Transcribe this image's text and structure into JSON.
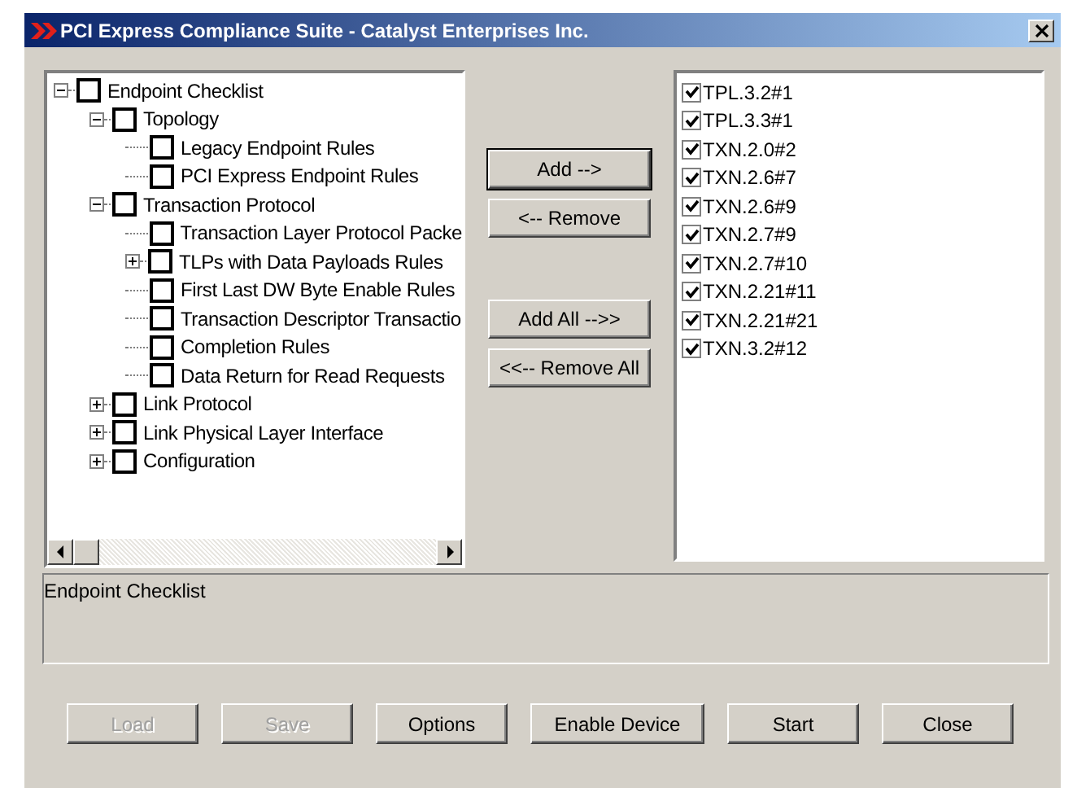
{
  "window": {
    "title": "PCI Express Compliance Suite - Catalyst Enterprises Inc."
  },
  "tree": [
    {
      "label": "Endpoint Checklist",
      "checked": false,
      "expanded": true,
      "children": [
        {
          "label": "Topology",
          "checked": false,
          "expanded": true,
          "children": [
            {
              "label": "Legacy Endpoint Rules",
              "checked": false
            },
            {
              "label": "PCI Express Endpoint Rules",
              "checked": false
            }
          ]
        },
        {
          "label": "Transaction Protocol",
          "checked": false,
          "expanded": true,
          "children": [
            {
              "label": "Transaction Layer Protocol Packe",
              "checked": false
            },
            {
              "label": "TLPs with Data Payloads Rules",
              "checked": false,
              "expanded": false
            },
            {
              "label": "First Last DW Byte Enable Rules",
              "checked": false
            },
            {
              "label": "Transaction Descriptor Transactio",
              "checked": false
            },
            {
              "label": "Completion Rules",
              "checked": false
            },
            {
              "label": "Data Return for Read Requests",
              "checked": false
            }
          ]
        },
        {
          "label": "Link Protocol",
          "checked": false,
          "expanded": false
        },
        {
          "label": "Link Physical Layer Interface",
          "checked": false,
          "expanded": false
        },
        {
          "label": "Configuration",
          "checked": false,
          "expanded": false
        }
      ]
    }
  ],
  "move_buttons": [
    {
      "label": "Add  -->",
      "focused": true
    },
    {
      "label": "<--  Remove",
      "focused": false
    },
    {
      "label": "Add All  -->>",
      "focused": false
    },
    {
      "label": "<<--  Remove All",
      "focused": false
    }
  ],
  "selected_list": [
    {
      "label": "TPL.3.2#1",
      "checked": true
    },
    {
      "label": "TPL.3.3#1",
      "checked": true
    },
    {
      "label": "TXN.2.0#2",
      "checked": true
    },
    {
      "label": "TXN.2.6#7",
      "checked": true
    },
    {
      "label": "TXN.2.6#9",
      "checked": true
    },
    {
      "label": "TXN.2.7#9",
      "checked": true
    },
    {
      "label": "TXN.2.7#10",
      "checked": true
    },
    {
      "label": "TXN.2.21#11",
      "checked": true
    },
    {
      "label": "TXN.2.21#21",
      "checked": true
    },
    {
      "label": "TXN.3.2#12",
      "checked": true
    }
  ],
  "description": "Endpoint Checklist",
  "buttons": [
    {
      "label": "Load",
      "disabled": true
    },
    {
      "label": "Save",
      "disabled": true
    },
    {
      "label": "Options",
      "disabled": false
    },
    {
      "label": "Enable Device",
      "disabled": false
    },
    {
      "label": "Start",
      "disabled": false
    },
    {
      "label": "Close",
      "disabled": false
    }
  ]
}
